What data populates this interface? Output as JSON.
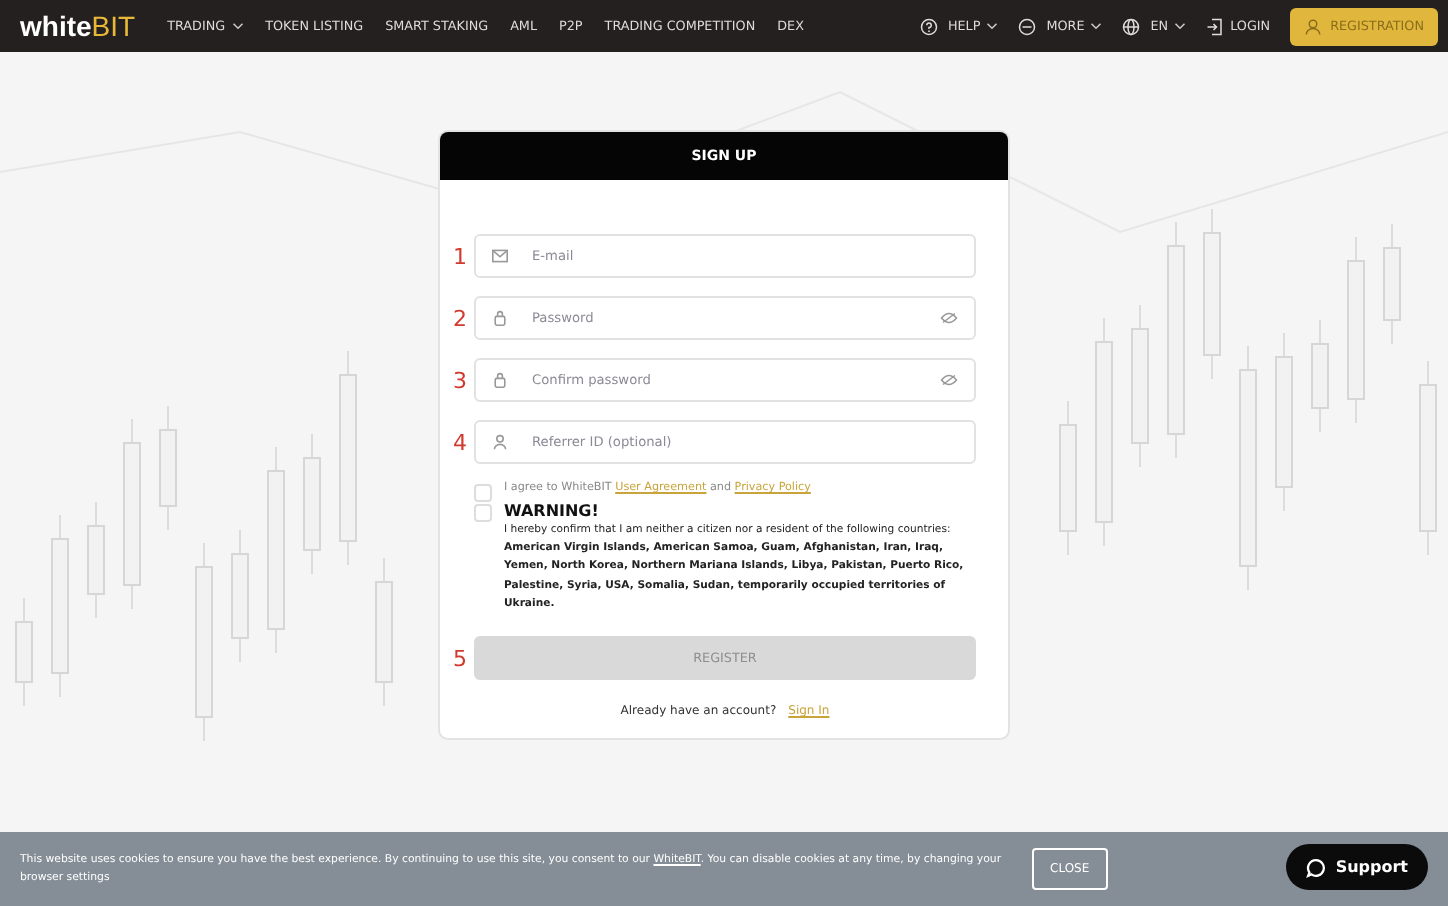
{
  "nav": {
    "logo_main": "white",
    "logo_accent": "BIT",
    "items": [
      {
        "label": "TRADING",
        "dropdown": true
      },
      {
        "label": "TOKEN LISTING",
        "dropdown": false
      },
      {
        "label": "SMART STAKING",
        "dropdown": false
      },
      {
        "label": "AML",
        "dropdown": false
      },
      {
        "label": "P2P",
        "dropdown": false
      },
      {
        "label": "TRADING COMPETITION",
        "dropdown": false
      },
      {
        "label": "DEX",
        "dropdown": false
      }
    ],
    "right_items": [
      {
        "label": "HELP",
        "kind": "help"
      },
      {
        "label": "MORE",
        "kind": "more"
      },
      {
        "label": "EN",
        "kind": "language"
      }
    ],
    "login": "LOGIN",
    "registration": "REGISTRATION"
  },
  "form": {
    "title": "SIGN UP",
    "fields": [
      {
        "marker": "1",
        "placeholder": "E-mail",
        "kind": "email",
        "toggle": false
      },
      {
        "marker": "2",
        "placeholder": "Password",
        "kind": "password",
        "toggle": true
      },
      {
        "marker": "3",
        "placeholder": "Confirm password",
        "kind": "password",
        "toggle": true
      },
      {
        "marker": "4",
        "placeholder": "Referrer ID (optional)",
        "kind": "referrer",
        "toggle": false
      }
    ],
    "agree": {
      "checked": false,
      "text": "I agree to WhiteBIT",
      "link1": "User Agreement",
      "and": "and",
      "link2": "Privacy Policy"
    },
    "warning": {
      "checked": false,
      "title": "WARNING!",
      "text": "I hereby confirm that I am neither a citizen nor a resident of the following countries:",
      "countries": "American Virgin Islands, American Samoa, Guam, Afghanistan, Iran, Iraq, Yemen, North Korea, Northern Mariana Islands, Libya, Pakistan, Puerto Rico, Palestine, Syria, USA, Somalia, Sudan, temporarily occupied territories of Ukraine."
    },
    "register_marker": "5",
    "register": {
      "label": "REGISTER",
      "disabled": true
    },
    "signin_text": "Already have an account?",
    "signin_link": "Sign In"
  },
  "cookie": {
    "text_before": "This website uses cookies to ensure you have the best experience. By continuing to use this site, you consent to our",
    "link": "WhiteBIT",
    "text_after": ". You can disable cookies at any time, by changing your browser settings",
    "close": "CLOSE"
  },
  "support": "Support"
}
